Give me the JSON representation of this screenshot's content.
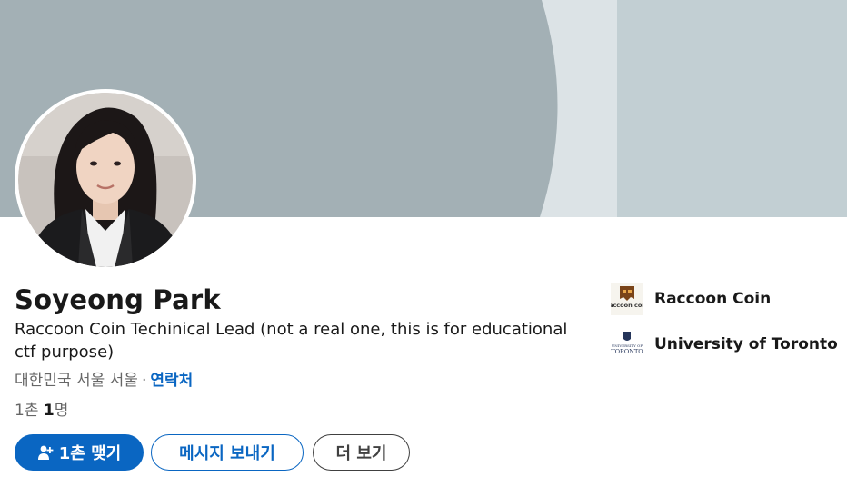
{
  "profile": {
    "name": "Soyeong Park",
    "headline": "Raccoon Coin Techinical Lead (not a real one, this is for educational ctf purpose)",
    "location": "대한민국 서울 서울",
    "separator": "·",
    "contact_label": "연락처",
    "connections_prefix": "1촌",
    "connections_count": "1",
    "connections_suffix": "명"
  },
  "actions": {
    "connect_label": "1촌 맺기",
    "message_label": "메시지 보내기",
    "more_label": "더 보기"
  },
  "sidebar": {
    "company": {
      "name": "Raccoon Coin",
      "logo_text": "raccoon coin",
      "icon": "raccoon-coin-logo"
    },
    "school": {
      "name": "University of Toronto",
      "logo_text_top": "UNIVERSITY OF",
      "logo_text": "TORONTO",
      "icon": "university-of-toronto-logo"
    }
  },
  "colors": {
    "accent": "#0a66c2",
    "banner_left": "#a0afb4",
    "banner_mid": "#dde4e8",
    "banner_right": "#c2cfd4"
  }
}
